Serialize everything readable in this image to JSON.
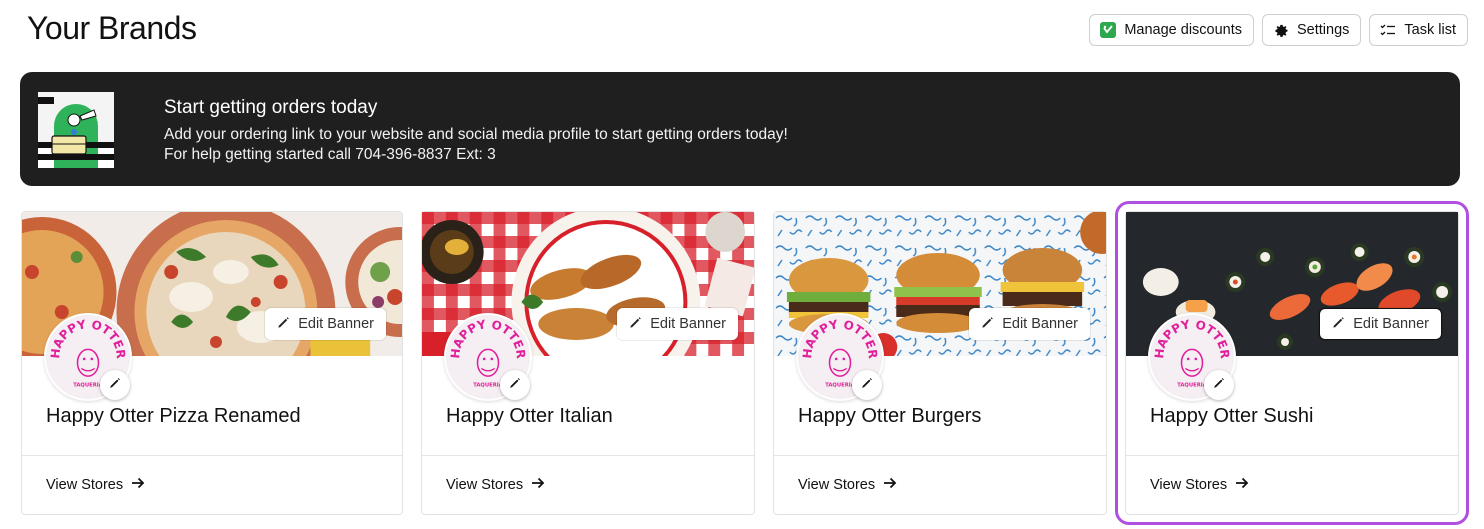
{
  "page": {
    "title": "Your Brands"
  },
  "actions": {
    "manage_discounts": "Manage discounts",
    "settings": "Settings",
    "task_list": "Task list"
  },
  "promo": {
    "title": "Start getting orders today",
    "line1": "Add your ordering link to your website and social media profile to start getting orders today!",
    "line2": "For help getting started call 704-396-8837 Ext: 3"
  },
  "cards": [
    {
      "name": "Happy Otter Pizza Renamed",
      "edit_banner": "Edit Banner",
      "view_stores": "View Stores",
      "banner_theme": "pizza"
    },
    {
      "name": "Happy Otter Italian",
      "edit_banner": "Edit Banner",
      "view_stores": "View Stores",
      "banner_theme": "italian"
    },
    {
      "name": "Happy Otter Burgers",
      "edit_banner": "Edit Banner",
      "view_stores": "View Stores",
      "banner_theme": "burgers"
    },
    {
      "name": "Happy Otter Sushi",
      "edit_banner": "Edit Banner",
      "view_stores": "View Stores",
      "banner_theme": "sushi",
      "selected": true
    }
  ],
  "logo": {
    "text": "HAPPY OTTER",
    "subtext": "TAQUERIA",
    "icon": "otter-logo-icon"
  },
  "colors": {
    "accent": "#b04fe0",
    "logo_pink": "#e0209a",
    "banner_bg": "#1f1f1f",
    "discount_green": "#2ea84f"
  }
}
